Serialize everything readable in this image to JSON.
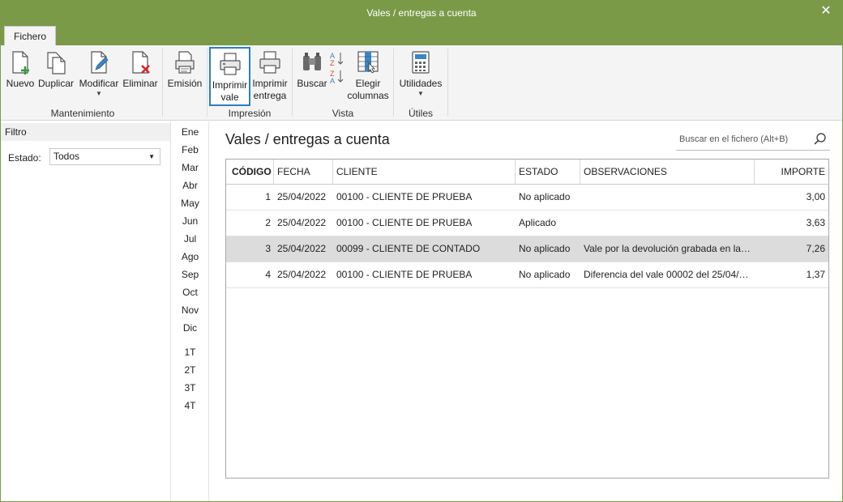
{
  "window": {
    "title": "Vales / entregas a cuenta",
    "close_label": "✕"
  },
  "tabs": [
    {
      "label": "Fichero",
      "active": true
    }
  ],
  "ribbon": {
    "groups": [
      {
        "label": "Mantenimiento",
        "buttons": [
          {
            "label": "Nuevo",
            "icon": "new-document-icon"
          },
          {
            "label": "Duplicar",
            "icon": "duplicate-icon"
          },
          {
            "label": "Modificar",
            "icon": "edit-document-icon",
            "has_dropdown": true
          },
          {
            "label": "Eliminar",
            "icon": "delete-document-icon"
          }
        ]
      },
      {
        "label": "",
        "buttons": [
          {
            "label": "Emisión",
            "icon": "emission-printer-icon"
          }
        ]
      },
      {
        "label": "Impresión",
        "buttons": [
          {
            "label_line1": "Imprimir",
            "label_line2": "vale",
            "icon": "printer-icon",
            "selected": true
          },
          {
            "label_line1": "Imprimir",
            "label_line2": "entrega",
            "icon": "printer-icon"
          }
        ]
      },
      {
        "label": "Vista",
        "buttons": [
          {
            "label": "Buscar",
            "icon": "binoculars-icon"
          },
          {
            "label": "",
            "icon": "sort-az-icon"
          },
          {
            "label_line1": "Elegir",
            "label_line2": "columnas",
            "icon": "columns-icon"
          }
        ]
      },
      {
        "label": "Útiles",
        "buttons": [
          {
            "label": "Utilidades",
            "icon": "calculator-icon",
            "has_dropdown": true
          }
        ]
      }
    ]
  },
  "filter": {
    "header": "Filtro",
    "estado_label": "Estado:",
    "estado_value": "Todos"
  },
  "months": [
    "Ene",
    "Feb",
    "Mar",
    "Abr",
    "May",
    "Jun",
    "Jul",
    "Ago",
    "Sep",
    "Oct",
    "Nov",
    "Dic"
  ],
  "quarters": [
    "1T",
    "2T",
    "3T",
    "4T"
  ],
  "main": {
    "title": "Vales / entregas a cuenta",
    "search_placeholder": "Buscar en el fichero (Alt+B)"
  },
  "table": {
    "columns": [
      "CÓDIGO",
      "FECHA",
      "CLIENTE",
      "ESTADO",
      "OBSERVACIONES",
      "IMPORTE"
    ],
    "rows": [
      {
        "codigo": "1",
        "fecha": "25/04/2022",
        "cliente": "00100 - CLIENTE DE PRUEBA",
        "estado": "No aplicado",
        "observaciones": "",
        "importe": "3,00",
        "selected": false
      },
      {
        "codigo": "2",
        "fecha": "25/04/2022",
        "cliente": "00100 - CLIENTE DE PRUEBA",
        "estado": "Aplicado",
        "observaciones": "",
        "importe": "3,63",
        "selected": false
      },
      {
        "codigo": "3",
        "fecha": "25/04/2022",
        "cliente": "00099 - CLIENTE DE CONTADO",
        "estado": "No aplicado",
        "observaciones": "Vale por la devolución grabada en la f...",
        "importe": "7,26",
        "selected": true
      },
      {
        "codigo": "4",
        "fecha": "25/04/2022",
        "cliente": "00100 - CLIENTE DE PRUEBA",
        "estado": "No aplicado",
        "observaciones": "Diferencia del vale 00002 del 25/04/20...",
        "importe": "1,37",
        "selected": false
      }
    ]
  },
  "colors": {
    "titlebar": "#7a9a48",
    "selection_border": "#2b7fc1",
    "selected_row": "#dcdcdc"
  }
}
